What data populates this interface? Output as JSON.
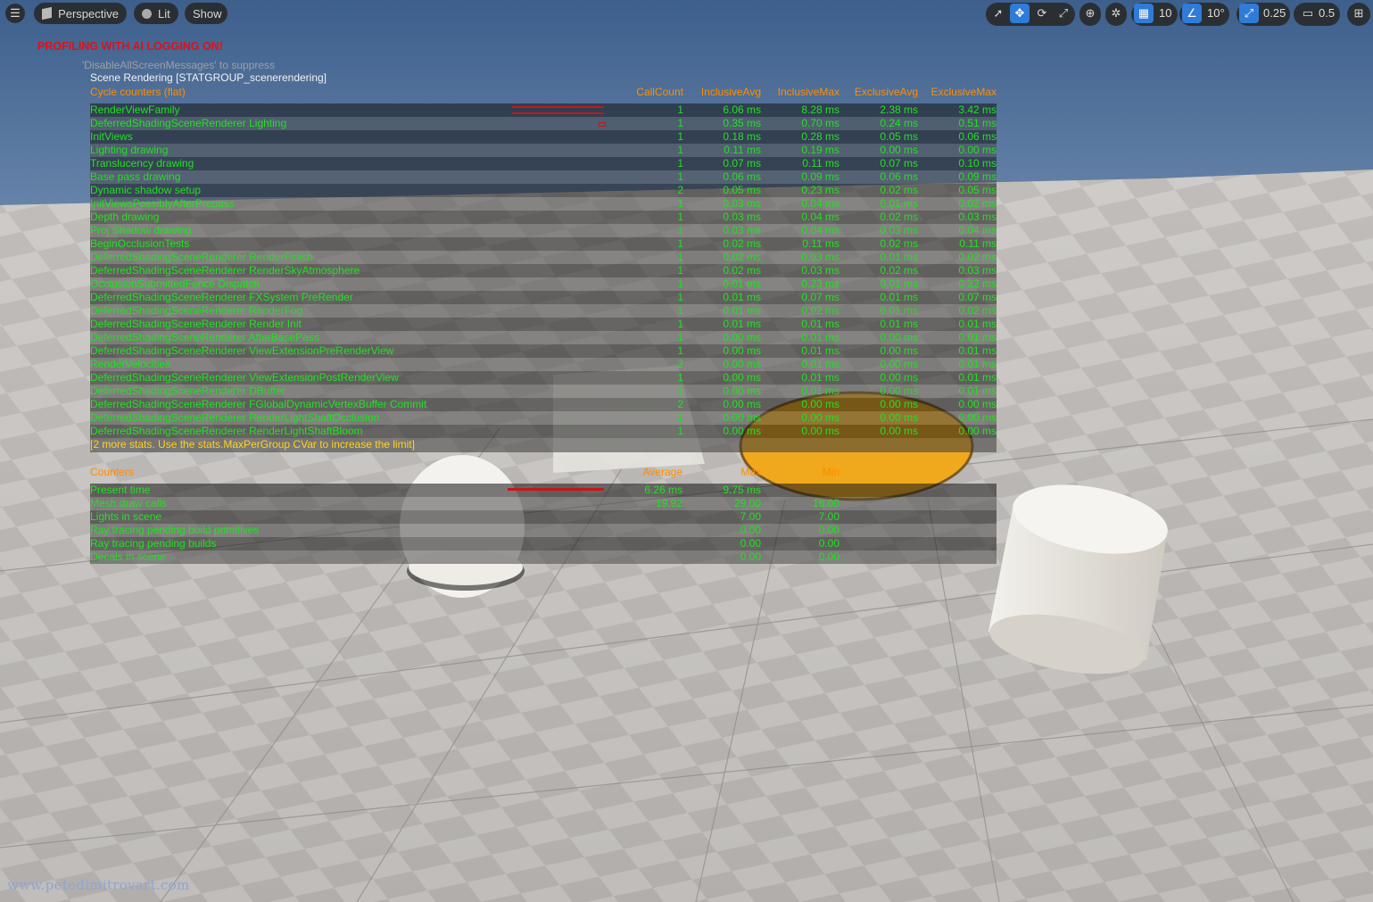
{
  "toolbar": {
    "menu_icon": "hamburger-icon",
    "perspective_label": "Perspective",
    "perspective_icon": "cube-icon",
    "lit_label": "Lit",
    "lit_icon": "sphere-icon",
    "show_label": "Show",
    "grid_snap_value": "10",
    "rotation_snap_value": "10°",
    "scale_snap_value": "0.25",
    "camera_speed_value": "0.5"
  },
  "overlay": {
    "warning": "PROFILING WITH AI LOGGING ON!",
    "warning_sub": "'DisableAllScreenMessages' to suppress"
  },
  "stats": {
    "title": "Scene Rendering [STATGROUP_scenerendering]",
    "cycle_header": {
      "name": "Cycle counters (flat)",
      "callcount": "CallCount",
      "inclusive_avg": "InclusiveAvg",
      "inclusive_max": "InclusiveMax",
      "exclusive_avg": "ExclusiveAvg",
      "exclusive_max": "ExclusiveMax"
    },
    "cycle_rows": [
      {
        "name": "RenderViewFamily",
        "calls": "1",
        "iavg": "6.06 ms",
        "imax": "8.28 ms",
        "eavg": "2.38 ms",
        "emax": "3.42 ms"
      },
      {
        "name": "DeferredShadingSceneRenderer Lighting",
        "calls": "1",
        "iavg": "0.35 ms",
        "imax": "0.70 ms",
        "eavg": "0.24 ms",
        "emax": "0.51 ms"
      },
      {
        "name": "InitViews",
        "calls": "1",
        "iavg": "0.18 ms",
        "imax": "0.28 ms",
        "eavg": "0.05 ms",
        "emax": "0.06 ms"
      },
      {
        "name": "Lighting drawing",
        "calls": "1",
        "iavg": "0.11 ms",
        "imax": "0.19 ms",
        "eavg": "0.00 ms",
        "emax": "0.00 ms"
      },
      {
        "name": "Translucency drawing",
        "calls": "1",
        "iavg": "0.07 ms",
        "imax": "0.11 ms",
        "eavg": "0.07 ms",
        "emax": "0.10 ms"
      },
      {
        "name": "Base pass drawing",
        "calls": "1",
        "iavg": "0.06 ms",
        "imax": "0.09 ms",
        "eavg": "0.06 ms",
        "emax": "0.09 ms"
      },
      {
        "name": "Dynamic shadow setup",
        "calls": "2",
        "iavg": "0.05 ms",
        "imax": "0.23 ms",
        "eavg": "0.02 ms",
        "emax": "0.05 ms"
      },
      {
        "name": "InitViewsPossiblyAfterPrepass",
        "calls": "1",
        "iavg": "0.03 ms",
        "imax": "0.04 ms",
        "eavg": "0.01 ms",
        "emax": "0.02 ms"
      },
      {
        "name": "Depth drawing",
        "calls": "1",
        "iavg": "0.03 ms",
        "imax": "0.04 ms",
        "eavg": "0.02 ms",
        "emax": "0.03 ms"
      },
      {
        "name": "Proj Shadow drawing",
        "calls": "1",
        "iavg": "0.03 ms",
        "imax": "0.04 ms",
        "eavg": "0.03 ms",
        "emax": "0.04 ms"
      },
      {
        "name": "BeginOcclusionTests",
        "calls": "1",
        "iavg": "0.02 ms",
        "imax": "0.11 ms",
        "eavg": "0.02 ms",
        "emax": "0.11 ms"
      },
      {
        "name": "DeferredShadingSceneRenderer RenderFinish",
        "calls": "1",
        "iavg": "0.02 ms",
        "imax": "0.03 ms",
        "eavg": "0.01 ms",
        "emax": "0.02 ms"
      },
      {
        "name": "DeferredShadingSceneRenderer RenderSkyAtmosphere",
        "calls": "1",
        "iavg": "0.02 ms",
        "imax": "0.03 ms",
        "eavg": "0.02 ms",
        "emax": "0.03 ms"
      },
      {
        "name": "OcclusionSubmittedFence Dispatch",
        "calls": "1",
        "iavg": "0.01 ms",
        "imax": "0.23 ms",
        "eavg": "0.01 ms",
        "emax": "0.22 ms"
      },
      {
        "name": "DeferredShadingSceneRenderer FXSystem PreRender",
        "calls": "1",
        "iavg": "0.01 ms",
        "imax": "0.07 ms",
        "eavg": "0.01 ms",
        "emax": "0.07 ms"
      },
      {
        "name": "DeferredShadingSceneRenderer RenderFog",
        "calls": "1",
        "iavg": "0.01 ms",
        "imax": "0.02 ms",
        "eavg": "0.01 ms",
        "emax": "0.02 ms"
      },
      {
        "name": "DeferredShadingSceneRenderer Render Init",
        "calls": "1",
        "iavg": "0.01 ms",
        "imax": "0.01 ms",
        "eavg": "0.01 ms",
        "emax": "0.01 ms"
      },
      {
        "name": "DeferredShadingSceneRenderer AfterBasePass",
        "calls": "1",
        "iavg": "0.00 ms",
        "imax": "0.01 ms",
        "eavg": "0.00 ms",
        "emax": "0.01 ms"
      },
      {
        "name": "DeferredShadingSceneRenderer ViewExtensionPreRenderView",
        "calls": "1",
        "iavg": "0.00 ms",
        "imax": "0.01 ms",
        "eavg": "0.00 ms",
        "emax": "0.01 ms"
      },
      {
        "name": "RenderVelocities",
        "calls": "2",
        "iavg": "0.00 ms",
        "imax": "0.01 ms",
        "eavg": "0.00 ms",
        "emax": "0.01 ms"
      },
      {
        "name": "DeferredShadingSceneRenderer ViewExtensionPostRenderView",
        "calls": "1",
        "iavg": "0.00 ms",
        "imax": "0.01 ms",
        "eavg": "0.00 ms",
        "emax": "0.01 ms"
      },
      {
        "name": "DeferredShadingSceneRenderer DBuffer",
        "calls": "1",
        "iavg": "0.00 ms",
        "imax": "0.01 ms",
        "eavg": "0.00 ms",
        "emax": "0.01 ms"
      },
      {
        "name": "DeferredShadingSceneRenderer FGlobalDynamicVertexBuffer Commit",
        "calls": "2",
        "iavg": "0.00 ms",
        "imax": "0.00 ms",
        "eavg": "0.00 ms",
        "emax": "0.00 ms"
      },
      {
        "name": "DeferredShadingSceneRenderer RenderLightShaftOcclusion",
        "calls": "1",
        "iavg": "0.00 ms",
        "imax": "0.00 ms",
        "eavg": "0.00 ms",
        "emax": "0.00 ms"
      },
      {
        "name": "DeferredShadingSceneRenderer RenderLightShaftBloom",
        "calls": "1",
        "iavg": "0.00 ms",
        "imax": "0.00 ms",
        "eavg": "0.00 ms",
        "emax": "0.00 ms"
      }
    ],
    "more_note": "[2 more stats. Use the stats.MaxPerGroup CVar to increase the limit]",
    "counter_header": {
      "name": "Counters",
      "average": "Average",
      "max": "Max",
      "min": "Min"
    },
    "counter_rows": [
      {
        "name": "Present time",
        "avg": "6.26 ms",
        "max": "9.75 ms",
        "min": ""
      },
      {
        "name": "Mesh draw calls",
        "avg": "19.92",
        "max": "29.00",
        "min": "16.00"
      },
      {
        "name": "Lights in scene",
        "avg": "",
        "max": "7.00",
        "min": "7.00"
      },
      {
        "name": "Ray tracing pending build primitives",
        "avg": "",
        "max": "0.00",
        "min": "0.00"
      },
      {
        "name": "Ray tracing pending builds",
        "avg": "",
        "max": "0.00",
        "min": "0.00"
      },
      {
        "name": "Decals in scene",
        "avg": "",
        "max": "0.00",
        "min": "0.00"
      }
    ]
  },
  "watermark": "www.petedimitrovart.com",
  "colors": {
    "stat_green": "#22e022",
    "header_orange": "#ff8c00",
    "warning_red": "#e0101a",
    "note_yellow": "#ffd21a",
    "accent_blue": "#2f7bd8"
  }
}
